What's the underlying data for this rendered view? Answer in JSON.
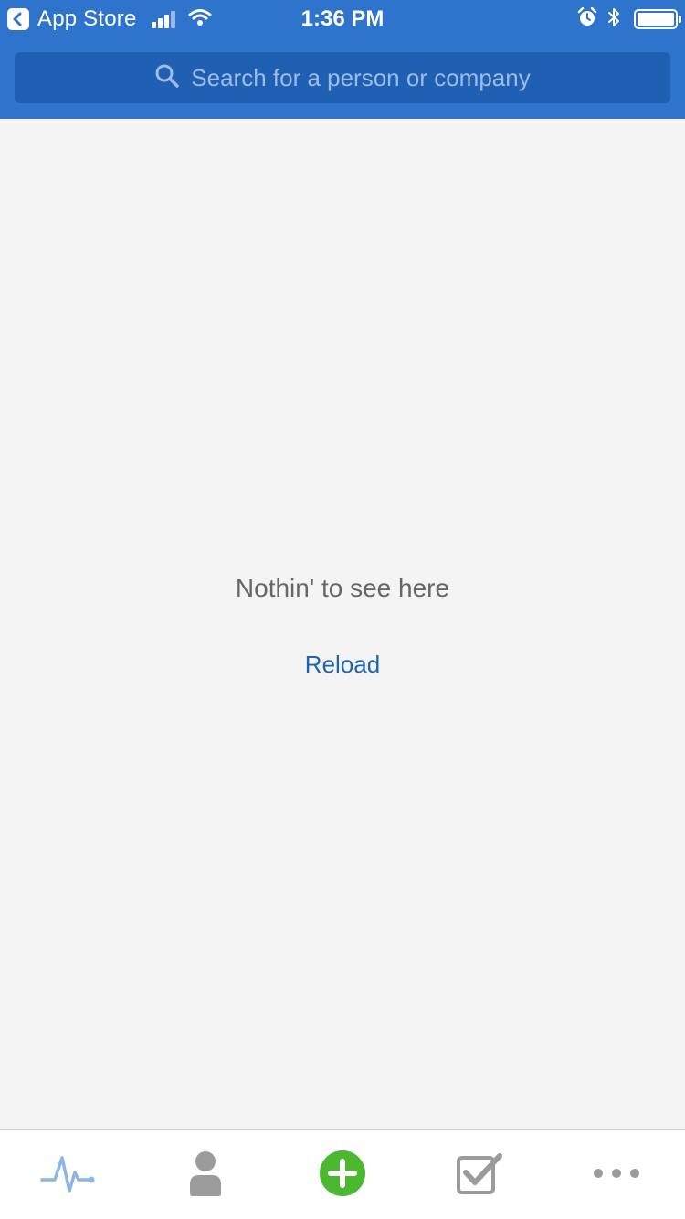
{
  "status_bar": {
    "back_app": "App Store",
    "time": "1:36 PM",
    "icons": [
      "back-chevron-icon",
      "signal-icon",
      "wifi-icon",
      "alarm-icon",
      "bluetooth-icon",
      "battery-icon"
    ]
  },
  "search": {
    "placeholder": "Search for a person or company",
    "icon": "search-icon"
  },
  "content": {
    "empty_message": "Nothin' to see here",
    "reload_label": "Reload"
  },
  "tab_bar": {
    "tabs": [
      {
        "icon": "activity-pulse-icon",
        "active": true
      },
      {
        "icon": "person-icon",
        "active": false
      },
      {
        "icon": "add-circle-icon",
        "active": false
      },
      {
        "icon": "checkbox-icon",
        "active": false
      },
      {
        "icon": "more-dots-icon",
        "active": false
      }
    ]
  },
  "colors": {
    "header": "#2e73cc",
    "search_field": "#1f60b3",
    "link": "#1f63b5",
    "add_button": "#4cb830",
    "active_tab": "#8cb4e6",
    "inactive_tab": "#9b9b9b"
  }
}
